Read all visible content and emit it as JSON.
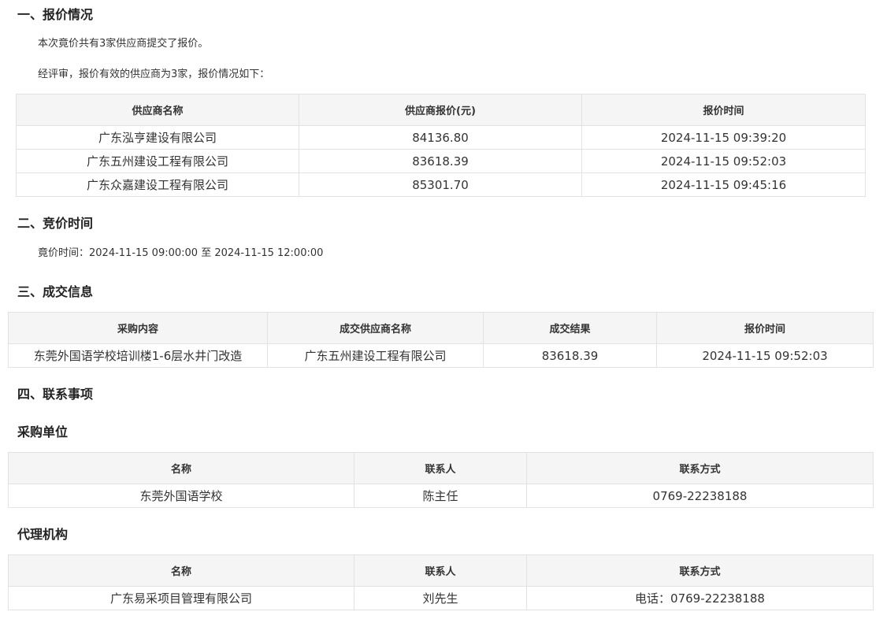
{
  "section1": {
    "heading": "一、报价情况",
    "para1": "本次竟价共有3家供应商提交了报价。",
    "para2": "经评审，报价有效的供应商为3家，报价情况如下：",
    "table": {
      "headers": [
        "供应商名称",
        "供应商报价(元)",
        "报价时间"
      ],
      "rows": [
        [
          "广东泓亨建设有限公司",
          "84136.80",
          "2024-11-15 09:39:20"
        ],
        [
          "广东五州建设工程有限公司",
          "83618.39",
          "2024-11-15 09:52:03"
        ],
        [
          "广东众嘉建设工程有限公司",
          "85301.70",
          "2024-11-15 09:45:16"
        ]
      ]
    }
  },
  "section2": {
    "heading": "二、竞价时间",
    "para": "竟价时间：2024-11-15 09:00:00 至 2024-11-15 12:00:00"
  },
  "section3": {
    "heading": "三、成交信息",
    "table": {
      "headers": [
        "采购内容",
        "成交供应商名称",
        "成交结果",
        "报价时间"
      ],
      "rows": [
        [
          "东莞外国语学校培训楼1-6层水井门改造",
          "广东五州建设工程有限公司",
          "83618.39",
          "2024-11-15 09:52:03"
        ]
      ]
    }
  },
  "section4": {
    "heading": "四、联系事项",
    "buyer": {
      "heading": "采购单位",
      "table": {
        "headers": [
          "名称",
          "联系人",
          "联系方式"
        ],
        "rows": [
          [
            "东莞外国语学校",
            "陈主任",
            "0769-22238188"
          ]
        ]
      }
    },
    "agency": {
      "heading": "代理机构",
      "table": {
        "headers": [
          "名称",
          "联系人",
          "联系方式"
        ],
        "rows": [
          [
            "广东易采项目管理有限公司",
            "刘先生",
            "电话：0769-22238188"
          ]
        ]
      }
    }
  }
}
